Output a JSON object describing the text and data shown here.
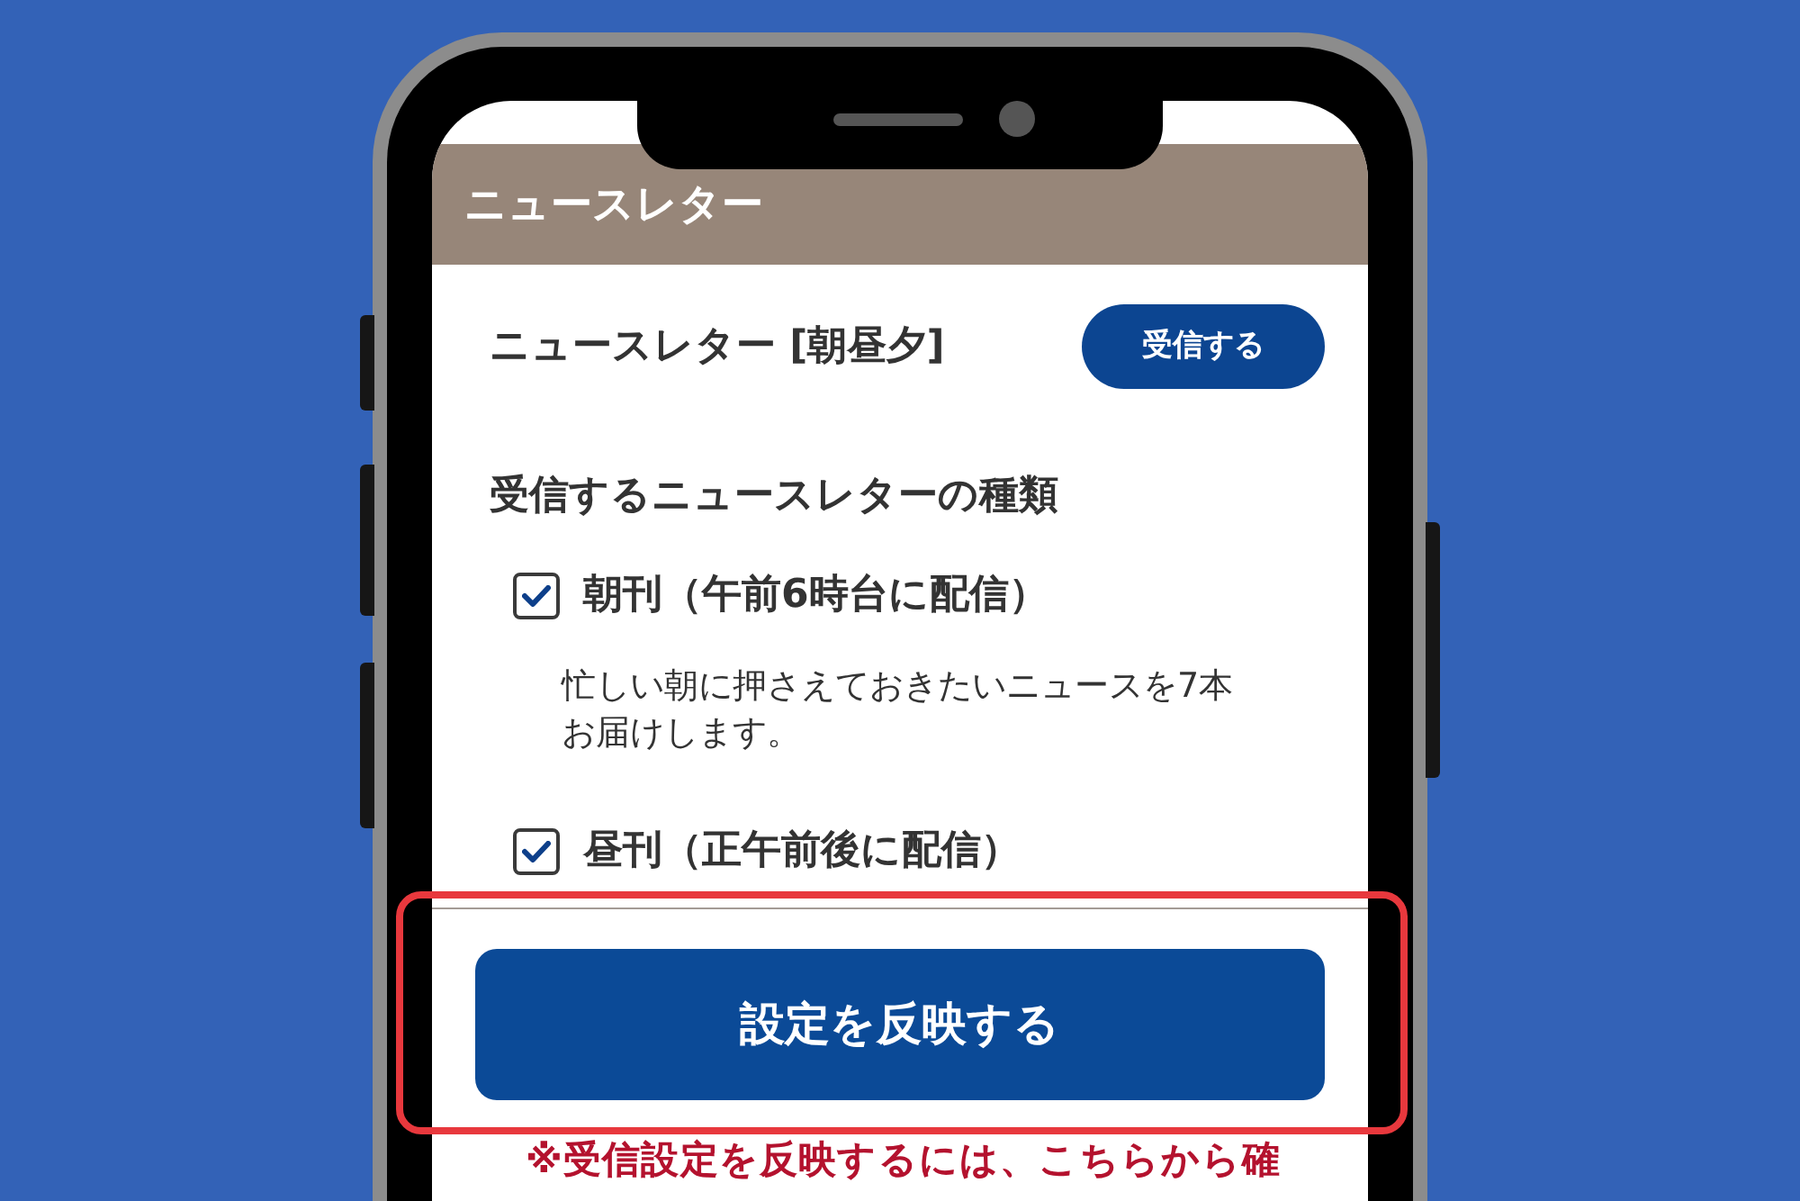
{
  "header": {
    "title": "ニュースレター"
  },
  "newsletter": {
    "title": "ニュースレター [朝昼夕]",
    "subscribe_button": "受信する"
  },
  "types": {
    "heading": "受信するニュースレターの種類",
    "items": [
      {
        "label": "朝刊（午前6時台に配信）",
        "checked": true,
        "description": "忙しい朝に押さえておきたいニュースを7本お届けします。"
      },
      {
        "label": "昼刊（正午前後に配信）",
        "checked": true
      }
    ]
  },
  "apply_button": {
    "label": "設定を反映する",
    "highlighted": true
  },
  "note": "※受信設定を反映するには、こちらから確"
}
